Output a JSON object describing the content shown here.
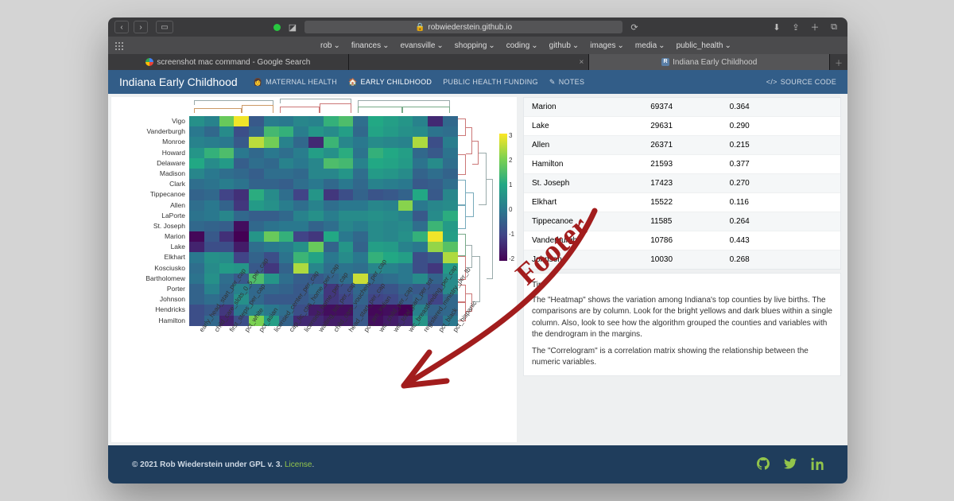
{
  "chrome": {
    "url_host": "robwiederstein.github.io",
    "bookmarks": [
      "rob",
      "finances",
      "evansville",
      "shopping",
      "coding",
      "github",
      "images",
      "media",
      "public_health"
    ],
    "tabs": [
      {
        "label": "screenshot mac command - Google Search",
        "active": false
      },
      {
        "label": "",
        "active": false
      },
      {
        "label": "Indiana Early Childhood",
        "active": true
      }
    ]
  },
  "site": {
    "title": "Indiana Early Childhood",
    "nav": [
      {
        "label": "MATERNAL HEALTH",
        "active": false
      },
      {
        "label": "EARLY CHILDHOOD",
        "active": true
      },
      {
        "label": "PUBLIC HEALTH FUNDING",
        "active": false
      },
      {
        "label": "NOTES",
        "active": false
      }
    ],
    "source_code": "SOURCE CODE"
  },
  "chart_data": {
    "type": "heatmap",
    "title": "",
    "colorbar": {
      "min": -2,
      "max": 3,
      "ticks": [
        "3",
        "2",
        "1",
        "0",
        "-1",
        "-2"
      ]
    },
    "y_categories": [
      "Vigo",
      "Vanderburgh",
      "Monroe",
      "Howard",
      "Delaware",
      "Madison",
      "Clark",
      "Tippecanoe",
      "Allen",
      "LaPorte",
      "St. Joseph",
      "Marion",
      "Lake",
      "Elkhart",
      "Kosciusko",
      "Bartholomew",
      "Porter",
      "Johnson",
      "Hendricks",
      "Hamilton"
    ],
    "x_categories": [
      "early_head_start_per_cap",
      "child_care_slots_0_5_per_cap",
      "first_steps_per_cap",
      "pct_white",
      "pct_asian",
      "licensed_center_per_cap",
      "cap_lic_ctrs_home_per_cap",
      "licensed_home_per_cap",
      "waiting_list_per_cap",
      "child_care_vouchers_per_cap",
      "head_start_per_cap",
      "pct_am_indian",
      "wic_child_per_cap",
      "wic_total_part_per_tot",
      "wic_breastfeeding_per_cap",
      "registered_ministry_per_lb",
      "pct_black",
      "pct_hispanic"
    ],
    "z": [
      [
        0.5,
        0.2,
        1.8,
        2.9,
        -0.6,
        0.1,
        0.0,
        0.3,
        0.2,
        1.2,
        1.5,
        -0.2,
        1.0,
        0.8,
        0.6,
        0.2,
        -1.4,
        -0.3
      ],
      [
        0.0,
        -0.3,
        0.4,
        -0.8,
        -0.4,
        1.4,
        1.2,
        0.1,
        0.6,
        0.4,
        0.8,
        -0.3,
        0.9,
        0.7,
        0.5,
        0.4,
        -0.1,
        -0.2
      ],
      [
        0.2,
        0.1,
        0.0,
        -0.6,
        2.5,
        1.9,
        0.2,
        -0.3,
        -1.4,
        1.3,
        0.3,
        0.0,
        0.4,
        0.3,
        0.2,
        2.4,
        -0.8,
        0.1
      ],
      [
        0.6,
        1.2,
        1.5,
        0.0,
        -0.3,
        0.0,
        -0.2,
        0.1,
        0.8,
        0.5,
        1.1,
        -0.1,
        1.2,
        1.0,
        0.8,
        -0.3,
        -0.6,
        -0.1
      ],
      [
        1.0,
        0.4,
        0.7,
        -0.5,
        -0.2,
        -0.3,
        0.2,
        0.0,
        0.3,
        1.5,
        1.4,
        0.2,
        1.0,
        0.9,
        0.7,
        -0.1,
        0.4,
        -0.2
      ],
      [
        0.3,
        0.0,
        -0.2,
        -0.3,
        -0.5,
        -0.2,
        -0.2,
        -0.3,
        0.3,
        0.3,
        0.6,
        -0.2,
        0.7,
        0.6,
        0.4,
        -0.4,
        -0.2,
        -0.4
      ],
      [
        -0.2,
        -0.1,
        0.1,
        -0.1,
        -0.4,
        -0.4,
        -0.5,
        -0.2,
        0.0,
        -0.3,
        0.0,
        -0.3,
        0.2,
        0.1,
        0.0,
        -0.6,
        -0.5,
        -0.2
      ],
      [
        -0.4,
        -0.3,
        -1.0,
        -1.3,
        1.1,
        0.4,
        -0.2,
        -1.0,
        0.6,
        -1.2,
        -0.8,
        -0.4,
        -0.7,
        -0.6,
        -0.4,
        1.0,
        -0.6,
        0.3
      ],
      [
        -0.2,
        0.0,
        -0.4,
        -1.2,
        0.7,
        0.5,
        0.1,
        -0.2,
        0.2,
        -0.2,
        0.0,
        0.0,
        0.3,
        0.2,
        2.1,
        0.0,
        0.3,
        0.4
      ],
      [
        -0.1,
        0.0,
        0.3,
        -0.3,
        -0.5,
        -0.5,
        -0.3,
        0.2,
        0.5,
        0.1,
        0.4,
        0.4,
        0.5,
        0.4,
        0.2,
        -0.6,
        0.4,
        1.1
      ],
      [
        -0.3,
        -0.4,
        -0.5,
        -1.8,
        -0.3,
        -0.1,
        0.0,
        0.0,
        -0.4,
        -0.2,
        0.3,
        0.1,
        0.4,
        0.3,
        0.4,
        -0.2,
        1.3,
        0.7
      ],
      [
        -1.9,
        -0.6,
        -1.3,
        -2.0,
        0.6,
        1.8,
        1.2,
        -1.0,
        -1.2,
        1.0,
        0.0,
        -0.3,
        0.4,
        0.3,
        0.5,
        1.2,
        2.9,
        0.8
      ],
      [
        -1.5,
        -0.8,
        -0.8,
        -1.6,
        -0.2,
        0.0,
        0.1,
        0.5,
        1.8,
        -0.4,
        0.6,
        -0.4,
        0.8,
        0.7,
        0.2,
        0.0,
        2.2,
        1.6
      ],
      [
        0.0,
        0.5,
        0.4,
        -1.0,
        -0.4,
        -0.8,
        -0.1,
        1.3,
        0.9,
        0.0,
        0.4,
        0.0,
        1.2,
        1.0,
        0.8,
        -0.8,
        -0.6,
        2.4
      ],
      [
        -0.2,
        0.4,
        0.7,
        0.6,
        -0.6,
        -1.2,
        -0.4,
        2.4,
        0.3,
        -0.2,
        -0.1,
        -0.2,
        0.3,
        0.2,
        0.0,
        -0.8,
        -1.2,
        0.7
      ],
      [
        -0.1,
        0.5,
        -0.2,
        -0.6,
        1.5,
        0.6,
        -0.2,
        -0.5,
        -0.6,
        -0.4,
        -0.2,
        2.6,
        -0.3,
        -0.2,
        0.0,
        0.4,
        -0.4,
        0.4
      ],
      [
        -0.4,
        0.2,
        -0.3,
        0.2,
        -0.3,
        -0.3,
        -0.4,
        -0.6,
        -0.2,
        -1.2,
        -0.8,
        -0.3,
        -0.8,
        -0.7,
        -0.4,
        -0.6,
        -0.7,
        0.4
      ],
      [
        -0.4,
        -0.2,
        -0.4,
        0.5,
        -0.3,
        -0.6,
        -0.6,
        -0.6,
        -0.4,
        -1.2,
        -1.0,
        -0.4,
        -1.0,
        -0.9,
        -0.6,
        -0.4,
        -1.0,
        -0.3
      ],
      [
        -0.8,
        -0.6,
        -1.2,
        0.0,
        0.3,
        0.0,
        -0.2,
        -0.8,
        -1.6,
        -1.8,
        -1.8,
        -0.6,
        -1.9,
        -1.8,
        -2.0,
        0.2,
        -0.4,
        -0.3
      ],
      [
        -0.8,
        -0.3,
        -1.5,
        -0.8,
        2.0,
        0.8,
        -0.4,
        -1.4,
        -1.4,
        -1.6,
        -1.6,
        -0.6,
        -1.8,
        -1.6,
        -1.4,
        0.6,
        -0.6,
        0.0
      ]
    ]
  },
  "table": {
    "rows": [
      {
        "county": "Marion",
        "val1": "69374",
        "val2": "0.364"
      },
      {
        "county": "Lake",
        "val1": "29631",
        "val2": "0.290"
      },
      {
        "county": "Allen",
        "val1": "26371",
        "val2": "0.215"
      },
      {
        "county": "Hamilton",
        "val1": "21593",
        "val2": "0.377"
      },
      {
        "county": "St. Joseph",
        "val1": "17423",
        "val2": "0.270"
      },
      {
        "county": "Elkhart",
        "val1": "15522",
        "val2": "0.116"
      },
      {
        "county": "Tippecanoe",
        "val1": "11585",
        "val2": "0.264"
      },
      {
        "county": "Vanderburgh",
        "val1": "10786",
        "val2": "0.443"
      },
      {
        "county": "Johnson",
        "val1": "10030",
        "val2": "0.268"
      }
    ]
  },
  "tip": {
    "title": "Tip",
    "p1": "The \"Heatmap\" shows the variation among Indiana's top counties by live births. The comparisons are by column. Look for the bright yellows and dark blues within a single column. Also, look to see how the algorithm grouped the counties and variables with the dendrogram in the margins.",
    "p2": "The \"Correlogram\" is a correlation matrix showing the relationship between the numeric variables."
  },
  "footer": {
    "text_prefix": "© 2021 Rob Wiederstein under GPL v. 3. ",
    "license": "License",
    "text_suffix": "."
  },
  "annotation": {
    "label": "Footer"
  }
}
